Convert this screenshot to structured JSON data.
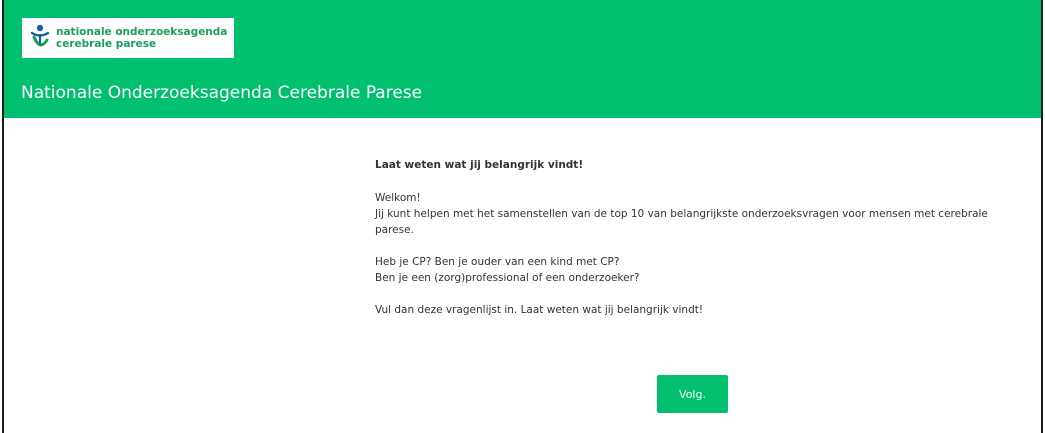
{
  "logo": {
    "line1": "nationale onderzoeksagenda",
    "line2": "cerebrale parese"
  },
  "header": {
    "title": "Nationale Onderzoeksagenda Cerebrale Parese"
  },
  "intro": {
    "heading": "Laat weten wat jij belangrijk vindt!",
    "welcome": "Welkom!",
    "paragraph1": "Jij kunt helpen met het samenstellen van de top 10 van belangrijkste onderzoeksvragen voor mensen met cerebrale parese.",
    "question1": "Heb je CP? Ben je ouder van een kind met CP?",
    "question2": "Ben je een (zorg)professional of een onderzoeker?",
    "call_to_action": "Vul dan deze vragenlijst in. Laat weten wat jij belangrijk vindt!"
  },
  "actions": {
    "next_label": "Volg."
  },
  "colors": {
    "brand_green": "#00c070",
    "logo_blue": "#1e5ea8",
    "logo_green": "#1b9e5a"
  }
}
